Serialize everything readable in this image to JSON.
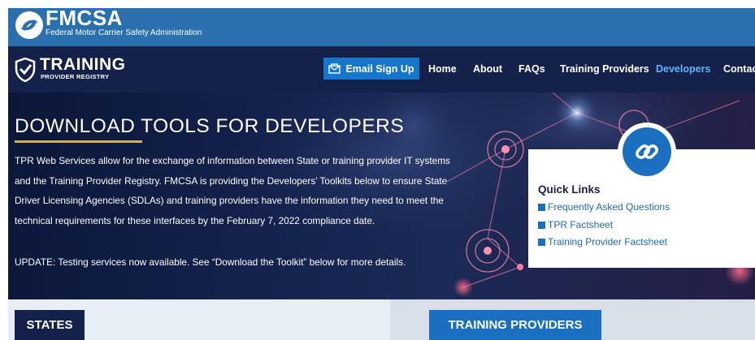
{
  "header": {
    "brand": "FMCSA",
    "subtitle": "Federal Motor Carrier Safety Administration"
  },
  "nav": {
    "logo_title": "TRAINING",
    "logo_subtitle": "PROVIDER REGISTRY",
    "email_signup": "Email Sign Up",
    "links": [
      "Home",
      "About",
      "FAQs",
      "Training Providers",
      "Developers",
      "Contact"
    ],
    "active": "Developers"
  },
  "hero": {
    "title": "DOWNLOAD TOOLS FOR DEVELOPERS",
    "description": "TPR Web Services allow for the exchange of information between State or training provider IT systems and the Training Provider Registry. FMCSA is providing the Developers’ Toolkits below to ensure State Driver Licensing Agencies (SDLAs) and training providers have the information they need to meet the technical requirements for these interfaces by the February 7, 2022 compliance date.",
    "update": "UPDATE: Testing services now available. See “Download the Toolkit” below for more details."
  },
  "quick_links": {
    "title": "Quick Links",
    "items": [
      "Frequently Asked Questions",
      "TPR Factsheet",
      "Training Provider Factsheet"
    ]
  },
  "sections": {
    "states": "STATES",
    "training_providers": "TRAINING PROVIDERS"
  },
  "colors": {
    "header_blue": "#2a6fae",
    "nav_navy": "#14214a",
    "accent_blue": "#1a6fc0",
    "underline_orange": "#f5a623",
    "active_link": "#5fb3ff"
  }
}
